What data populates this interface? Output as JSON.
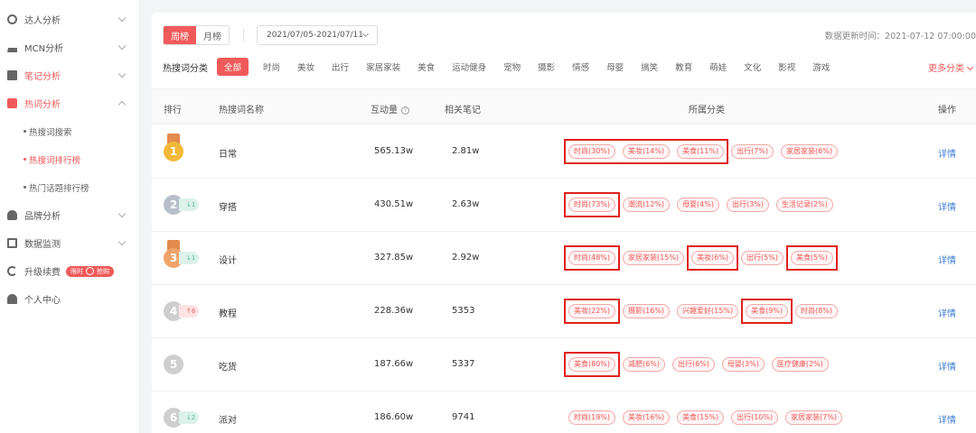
{
  "sidebar": {
    "items": [
      {
        "label": "达人分析",
        "icon": "gear-icon"
      },
      {
        "label": "MCN分析",
        "icon": "crown-icon"
      },
      {
        "label": "笔记分析",
        "icon": "notebook-icon"
      },
      {
        "label": "热词分析",
        "icon": "fire-icon"
      },
      {
        "label": "品牌分析",
        "icon": "brand-icon"
      },
      {
        "label": "数据监测",
        "icon": "monitor-icon"
      },
      {
        "label": "升级续费",
        "icon": "upgrade-icon"
      },
      {
        "label": "个人中心",
        "icon": "user-icon"
      }
    ],
    "sub_items": [
      "热搜词搜索",
      "热搜词排行榜",
      "热门话题排行榜"
    ],
    "promo_left": "限时",
    "promo_right": "抢购"
  },
  "header": {
    "toggle_week": "周榜",
    "toggle_month": "月榜",
    "date_range": "2021/07/05-2021/07/11",
    "updated": "数据更新时间：2021-07-12 07:00:00"
  },
  "categories": {
    "label": "热搜词分类",
    "items": [
      "全部",
      "时尚",
      "美妆",
      "出行",
      "家居家装",
      "美食",
      "运动健身",
      "宠物",
      "摄影",
      "情感",
      "母婴",
      "搞笑",
      "教育",
      "萌娃",
      "文化",
      "影视",
      "游戏"
    ],
    "more": "更多分类"
  },
  "table": {
    "headers": {
      "rank": "排行",
      "name": "热搜词名称",
      "interactions": "互动量",
      "notes": "相关笔记",
      "categories": "所属分类",
      "action": "操作"
    },
    "detail_label": "详情",
    "rows": [
      {
        "rank": "1",
        "change": "",
        "name": "日常",
        "interactions": "565.13w",
        "notes": "2.81w",
        "tags": [
          "时尚(30%)",
          "美妆(14%)",
          "美食(11%)",
          "出行(7%)",
          "家居家装(6%)"
        ]
      },
      {
        "rank": "2",
        "change": "↓1",
        "name": "穿搭",
        "interactions": "430.51w",
        "notes": "2.63w",
        "tags": [
          "时尚(73%)",
          "潮流(12%)",
          "母婴(4%)",
          "出行(3%)",
          "生活记录(2%)"
        ]
      },
      {
        "rank": "3",
        "change": "↓1",
        "name": "设计",
        "interactions": "327.85w",
        "notes": "2.92w",
        "tags": [
          "时尚(48%)",
          "家居家装(15%)",
          "美妆(6%)",
          "出行(5%)",
          "美食(5%)"
        ]
      },
      {
        "rank": "4",
        "change": "↑6",
        "name": "教程",
        "interactions": "228.36w",
        "notes": "5353",
        "tags": [
          "美妆(22%)",
          "摄影(16%)",
          "兴趣爱好(15%)",
          "美食(9%)",
          "时尚(8%)"
        ]
      },
      {
        "rank": "5",
        "change": "",
        "name": "吃货",
        "interactions": "187.66w",
        "notes": "5337",
        "tags": [
          "美食(80%)",
          "减肥(6%)",
          "出行(6%)",
          "母婴(3%)",
          "医疗健康(2%)"
        ]
      },
      {
        "rank": "6",
        "change": "↓2",
        "name": "派对",
        "interactions": "186.60w",
        "notes": "9741",
        "tags": [
          "时尚(19%)",
          "美妆(16%)",
          "美食(15%)",
          "出行(10%)",
          "家居家装(7%)"
        ]
      }
    ]
  },
  "colors": {
    "accent": "#f05a5a",
    "link": "#3b7bd6",
    "highlight": "#e02020"
  }
}
